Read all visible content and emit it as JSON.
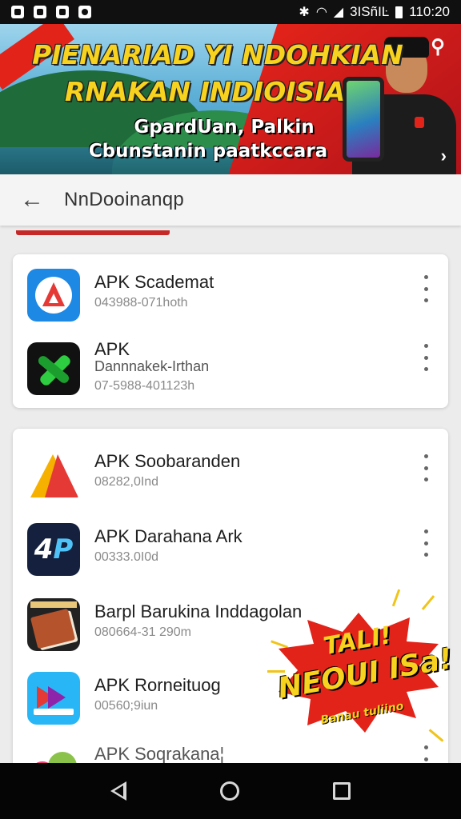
{
  "status_bar": {
    "time": "110:20",
    "carrier_text": "3ISñIĿ",
    "left_icons": [
      "image-icon",
      "sim-icon",
      "notification-icon",
      "sync-icon"
    ],
    "right_icons": [
      "bluetooth-icon",
      "wifi-icon",
      "signal-icon",
      "battery-icon"
    ]
  },
  "banner": {
    "ribbon_text": "",
    "title_line1": "PIENARIAD YI NDOHKIAN",
    "title_line2": "RNAKAN INDIOISIA",
    "subtitle_line1": "GpardUan, Palkin",
    "subtitle_line2": "Cbunstanin paatkccara",
    "colors": {
      "title": "#f7d21e",
      "red": "#e2231a"
    }
  },
  "app_bar": {
    "title": "NnDooinanqp"
  },
  "cards": [
    {
      "items": [
        {
          "name": "APK Scademat",
          "meta": "043988-071hoth",
          "icon": "a-logo-icon"
        },
        {
          "name": "APK",
          "name2": "Dannnakek-Irthan",
          "meta": "07-5988-401123h",
          "icon": "x-logo-icon"
        }
      ]
    },
    {
      "items": [
        {
          "name": "APK Soobaranden",
          "meta": "08282,0Ind",
          "icon": "triangle-logo-icon"
        },
        {
          "name": "APK Darahana Ark",
          "meta": "00333.0I0d",
          "icon": "ap-logo-icon"
        },
        {
          "name": "Barpl Barukina Inddagolan",
          "meta": "080664-31 290m",
          "icon": "book-icon"
        },
        {
          "name": "APK Rorneituog",
          "meta": "00560;9iun",
          "icon": "arrows-logo-icon"
        },
        {
          "name": "APK Soqrakana¦",
          "meta": "",
          "icon": "droid-logo-icon"
        }
      ]
    }
  ],
  "promo": {
    "line1": "TALI!",
    "line2": "NEOUI ISa!",
    "line3": "Banau tuliino"
  },
  "nav": {
    "buttons": [
      "back",
      "home",
      "recents"
    ]
  }
}
